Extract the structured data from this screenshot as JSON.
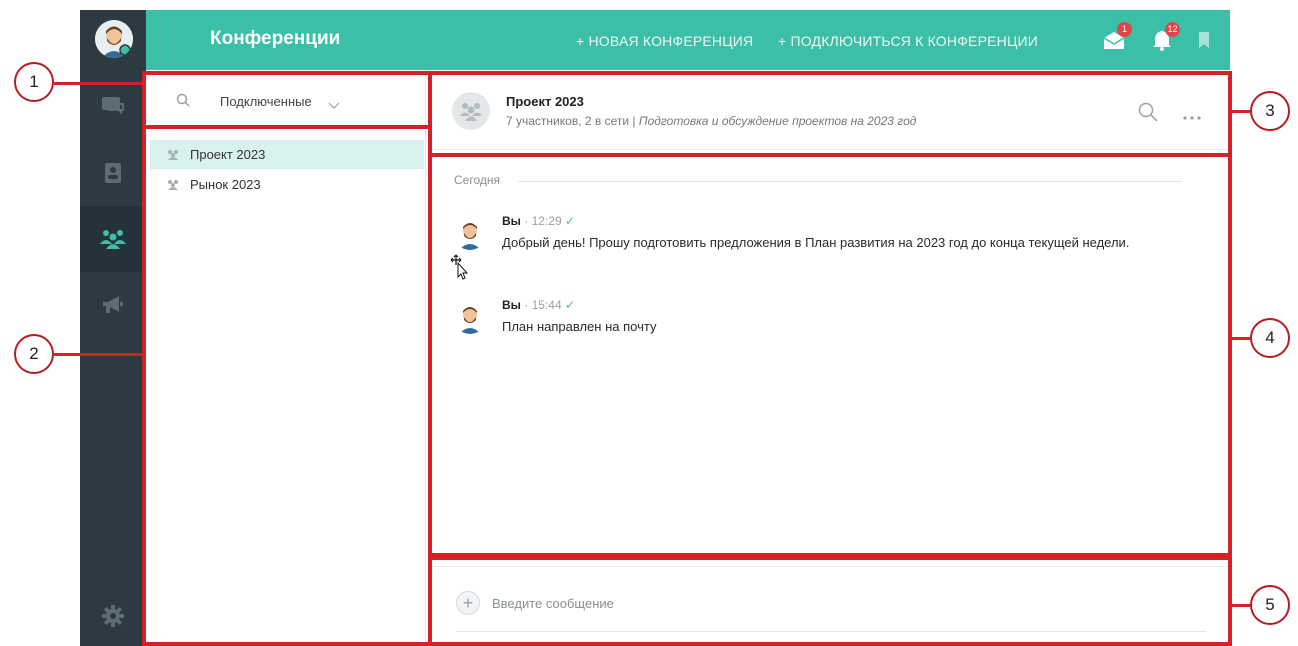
{
  "app": {
    "title": "Конференции",
    "accent_color": "#3cbfa7",
    "sidebar_color": "#2e3a42",
    "nav": [
      {
        "icon": "chat-icon"
      },
      {
        "icon": "contacts-icon"
      },
      {
        "icon": "conferences-icon",
        "active": true
      },
      {
        "icon": "broadcast-icon"
      }
    ],
    "settings_icon": "gear-icon"
  },
  "topbar": {
    "new_conference": "+ НОВАЯ КОНФЕРЕНЦИЯ",
    "join_conference": "+ ПОДКЛЮЧИТЬСЯ К КОНФЕРЕНЦИИ",
    "messages_badge": "1",
    "notifications_badge": "12"
  },
  "list": {
    "filter": "Подключенные",
    "items": [
      {
        "label": "Проект 2023",
        "active": true
      },
      {
        "label": "Рынок 2023",
        "active": false
      }
    ]
  },
  "chat": {
    "title": "Проект 2023",
    "members": "7 участников, 2 в сети",
    "separator": "|",
    "description": "Подготовка и обсуждение проектов на 2023 год",
    "date_label": "Сегодня",
    "messages": [
      {
        "author": "Вы",
        "time": "12:29",
        "text": "Добрый день! Прошу подготовить предложения в План развития на 2023 год до конца текущей недели."
      },
      {
        "author": "Вы",
        "time": "15:44",
        "text": "План направлен на почту"
      }
    ]
  },
  "composer": {
    "add_symbol": "+",
    "placeholder": "Введите сообщение"
  },
  "annotations": {
    "color": "#d42027",
    "labels": [
      "1",
      "2",
      "3",
      "4",
      "5"
    ]
  }
}
